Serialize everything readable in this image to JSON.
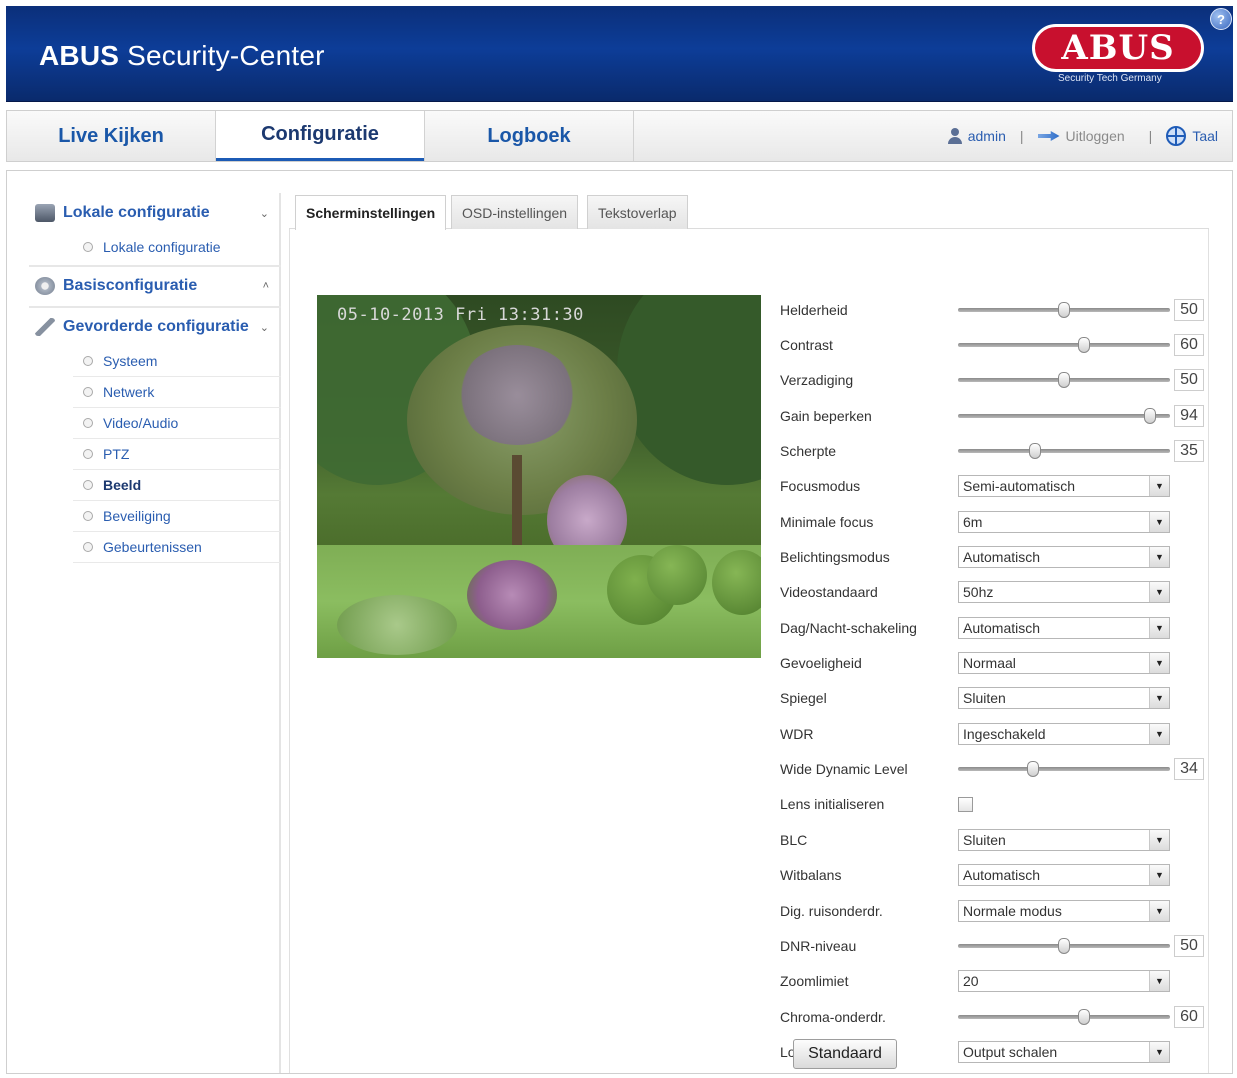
{
  "header": {
    "title_bold": "ABUS",
    "title_rest": " Security-Center",
    "logo_text": "ABUS",
    "logo_subtitle": "Security Tech Germany",
    "help_icon": "?"
  },
  "nav": {
    "tabs": [
      {
        "label": "Live Kijken"
      },
      {
        "label": "Configuratie"
      },
      {
        "label": "Logboek"
      }
    ],
    "user": "admin",
    "separator": "|",
    "logout": "Uitloggen",
    "language": "Taal"
  },
  "sidebar": {
    "local_config": "Lokale configuratie",
    "local_items": [
      "Lokale configuratie"
    ],
    "basic_config": "Basisconfiguratie",
    "advanced_config": "Gevorderde configuratie",
    "advanced_items": [
      "Systeem",
      "Netwerk",
      "Video/Audio",
      "PTZ",
      "Beeld",
      "Beveiliging",
      "Gebeurtenissen"
    ],
    "chevron_down": "⌄",
    "chevron_up": "˄"
  },
  "tabs": [
    "Scherminstellingen",
    "OSD-instellingen",
    "Tekstoverlap"
  ],
  "preview": {
    "osd_time": "05-10-2013 Fri 13:31:30"
  },
  "settings": [
    {
      "label": "Helderheid",
      "type": "slider",
      "value": 50
    },
    {
      "label": "Contrast",
      "type": "slider",
      "value": 60
    },
    {
      "label": "Verzadiging",
      "type": "slider",
      "value": 50
    },
    {
      "label": "Gain beperken",
      "type": "slider",
      "value": 94
    },
    {
      "label": "Scherpte",
      "type": "slider",
      "value": 35
    },
    {
      "label": "Focusmodus",
      "type": "select",
      "value": "Semi-automatisch"
    },
    {
      "label": "Minimale focus",
      "type": "select",
      "value": "6m"
    },
    {
      "label": "Belichtingsmodus",
      "type": "select",
      "value": "Automatisch"
    },
    {
      "label": "Videostandaard",
      "type": "select",
      "value": "50hz"
    },
    {
      "label": "Dag/Nacht-schakeling",
      "type": "select",
      "value": "Automatisch"
    },
    {
      "label": "Gevoeligheid",
      "type": "select",
      "value": "Normaal"
    },
    {
      "label": "Spiegel",
      "type": "select",
      "value": "Sluiten"
    },
    {
      "label": "WDR",
      "type": "select",
      "value": "Ingeschakeld"
    },
    {
      "label": "Wide Dynamic Level",
      "type": "slider",
      "value": 34
    },
    {
      "label": "Lens initialiseren",
      "type": "checkbox",
      "value": false
    },
    {
      "label": "BLC",
      "type": "select",
      "value": "Sluiten"
    },
    {
      "label": "Witbalans",
      "type": "select",
      "value": "Automatisch"
    },
    {
      "label": "Dig. ruisonderdr.",
      "type": "select",
      "value": "Normale modus"
    },
    {
      "label": "DNR-niveau",
      "type": "slider",
      "value": 50
    },
    {
      "label": "Zoomlimiet",
      "type": "select",
      "value": "20"
    },
    {
      "label": "Chroma-onderdr.",
      "type": "slider",
      "value": 60
    },
    {
      "label": "Lokale output",
      "type": "select",
      "value": "Output schalen"
    }
  ],
  "default_button": "Standaard",
  "select_arrow": "▼"
}
